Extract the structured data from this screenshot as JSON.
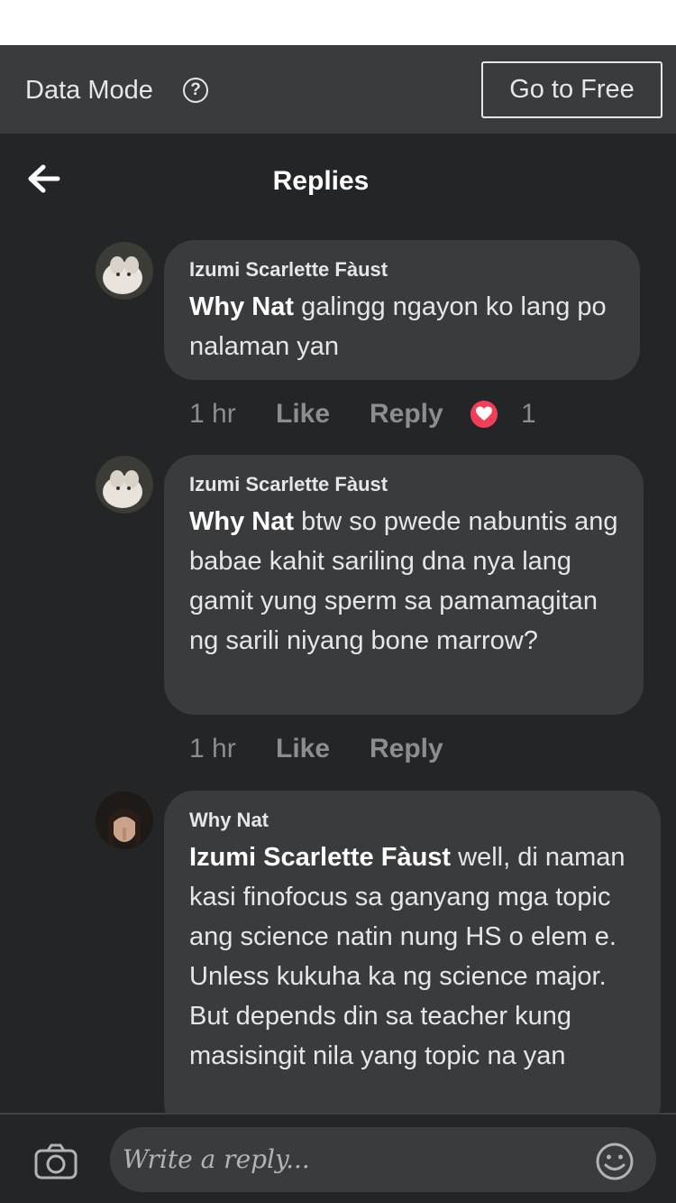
{
  "data_mode": {
    "label": "Data Mode",
    "help_icon": "help-circle-icon",
    "free_button": "Go to Free"
  },
  "header": {
    "back_icon": "arrow-left-icon",
    "title": "Replies"
  },
  "comments": [
    {
      "author": "Izumi Scarlette Fàust",
      "mention": "Why Nat",
      "text": "galingg ngayon ko lang po nalaman yan",
      "time": "1 hr",
      "like": "Like",
      "reply": "Reply",
      "reaction": {
        "icon": "heart-reaction-icon",
        "count": "1",
        "color": "#f33e58"
      }
    },
    {
      "author": "Izumi Scarlette Fàust",
      "mention": "Why Nat",
      "text": "btw so pwede nabuntis ang babae kahit sariling dna nya lang gamit yung sperm sa pamamagitan ng sarili niyang bone marrow?",
      "time": "1 hr",
      "like": "Like",
      "reply": "Reply"
    },
    {
      "author": "Why Nat",
      "mention": "Izumi Scarlette Fàust",
      "text": "well, di naman kasi finofocus sa ganyang  mga topic ang science natin nung HS o elem e. Unless kukuha ka ng science major. But depends din sa teacher kung masisingit nila yang topic na yan"
    }
  ],
  "composer": {
    "camera_icon": "camera-icon",
    "placeholder": "Write a reply...",
    "emoji_icon": "smiley-icon"
  },
  "colors": {
    "background": "#242526",
    "bubble": "#3a3b3c",
    "meta_text": "#8a8d91"
  }
}
